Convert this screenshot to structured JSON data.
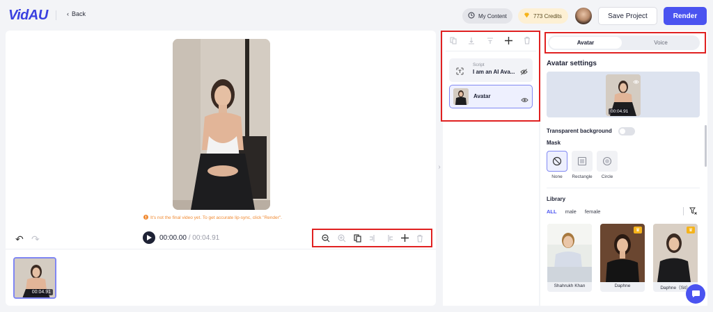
{
  "header": {
    "logo": "VidAU",
    "back_label": "Back",
    "my_content_label": "My Content",
    "credits_label": "773 Credits",
    "save_label": "Save Project",
    "render_label": "Render"
  },
  "canvas": {
    "notice": "It's not the final video yet. To get accurate lip-sync, click \"Render\".",
    "time_current": "00:00.00",
    "time_separator": " / ",
    "time_total": "00:04.91",
    "toolbar": [
      "zoom-out-icon",
      "zoom-in-icon",
      "copy-icon",
      "split-left-icon",
      "split-right-icon",
      "add-icon",
      "delete-icon"
    ],
    "clip_duration": "00:04.91"
  },
  "layers": {
    "tools": [
      "copy-icon",
      "align-bottom-icon",
      "align-center-icon",
      "add-icon",
      "delete-icon"
    ],
    "items": [
      {
        "kind": "Script",
        "title": "I am an AI Ava..."
      },
      {
        "kind": "",
        "title": "Avatar"
      }
    ]
  },
  "settings": {
    "tabs": [
      "Avatar",
      "Voice"
    ],
    "active_tab": "Avatar",
    "title": "Avatar settings",
    "preview_duration": "00:04.91",
    "transparent_label": "Transparent background",
    "transparent_on": false,
    "mask_label": "Mask",
    "mask_options": [
      "None",
      "Rectangle",
      "Circle"
    ],
    "mask_selected": "None",
    "library_label": "Library",
    "filters": [
      "ALL",
      "male",
      "female"
    ],
    "filter_selected": "ALL",
    "library": [
      {
        "name": "Shahrukh Khan",
        "premium": false
      },
      {
        "name": "Daphne",
        "premium": true
      },
      {
        "name": "Daphne（Sit）",
        "premium": true
      }
    ]
  },
  "colors": {
    "accent": "#4a53f0",
    "highlight": "#e02020",
    "notice": "#f08a32"
  }
}
